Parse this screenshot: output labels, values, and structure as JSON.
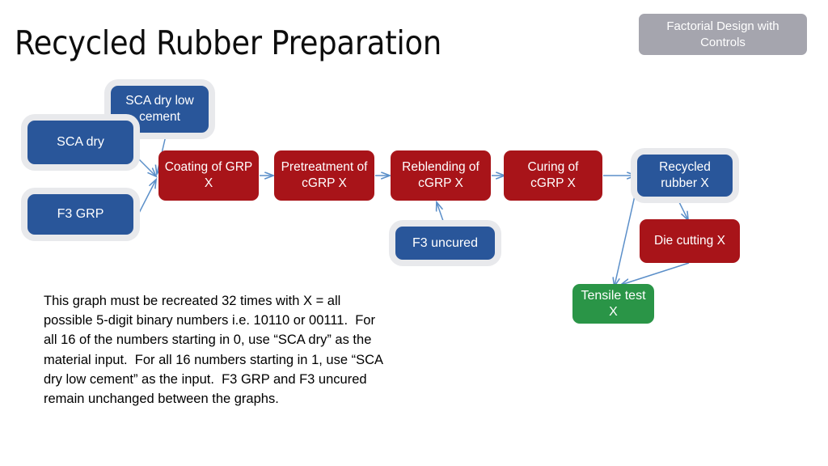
{
  "slide": {
    "title": "Recycled Rubber Preparation",
    "background_color": "#ffffff"
  },
  "corner_badge": {
    "label": "Factorial Design with Controls",
    "color": "#a5a5ae",
    "text_color": "#ffffff"
  },
  "colors": {
    "input_blue": "#29569a",
    "process_red": "#a81419",
    "test_green": "#2a9547",
    "badge_gray": "#a5a5ae",
    "arrow_blue": "#5b8fc9",
    "halo_gray": "#e8e9ec"
  },
  "nodes": [
    {
      "id": "sca-dry-low-cement",
      "label": "SCA dry low cement",
      "type": "input",
      "color": "#29569a"
    },
    {
      "id": "sca-dry",
      "label": "SCA dry",
      "type": "input",
      "color": "#29569a"
    },
    {
      "id": "f3-grp",
      "label": "F3 GRP",
      "type": "input",
      "color": "#29569a"
    },
    {
      "id": "coating",
      "label": "Coating of GRP X",
      "type": "process",
      "color": "#a81419"
    },
    {
      "id": "pretreatment",
      "label": "Pretreatment of cGRP X",
      "type": "process",
      "color": "#a81419"
    },
    {
      "id": "reblending",
      "label": "Reblending of cGRP X",
      "type": "process",
      "color": "#a81419"
    },
    {
      "id": "curing",
      "label": "Curing of cGRP X",
      "type": "process",
      "color": "#a81419"
    },
    {
      "id": "f3-uncured",
      "label": "F3 uncured",
      "type": "input",
      "color": "#29569a"
    },
    {
      "id": "recycled-rubber",
      "label": "Recycled rubber X",
      "type": "output",
      "color": "#29569a"
    },
    {
      "id": "die-cutting",
      "label": "Die cutting X",
      "type": "process",
      "color": "#a81419"
    },
    {
      "id": "tensile-test",
      "label": "Tensile test X",
      "type": "test",
      "color": "#2a9547"
    }
  ],
  "connections": [
    {
      "from": "sca-dry-low-cement",
      "to": "coating",
      "arrow": "single"
    },
    {
      "from": "sca-dry",
      "to": "coating",
      "arrow": "single"
    },
    {
      "from": "f3-grp",
      "to": "coating",
      "arrow": "single"
    },
    {
      "from": "coating",
      "to": "pretreatment",
      "arrow": "single"
    },
    {
      "from": "pretreatment",
      "to": "reblending",
      "arrow": "single"
    },
    {
      "from": "f3-uncured",
      "to": "reblending",
      "arrow": "single"
    },
    {
      "from": "reblending",
      "to": "curing",
      "arrow": "single"
    },
    {
      "from": "curing",
      "to": "recycled-rubber",
      "arrow": "single"
    },
    {
      "from": "recycled-rubber",
      "to": "die-cutting",
      "arrow": "single"
    },
    {
      "from": "die-cutting",
      "to": "tensile-test",
      "arrow": "single"
    },
    {
      "from": "tensile-test",
      "to": "recycled-rubber",
      "arrow": "double"
    }
  ],
  "body_text": "This graph must be recreated 32 times with X = all possible 5-digit binary numbers i.e. 10110 or 00111.  For all 16 of the numbers starting in 0, use “SCA dry” as the material input.  For all 16 numbers starting in 1, use “SCA dry low cement” as the input.  F3 GRP and F3 uncured remain unchanged between the graphs."
}
